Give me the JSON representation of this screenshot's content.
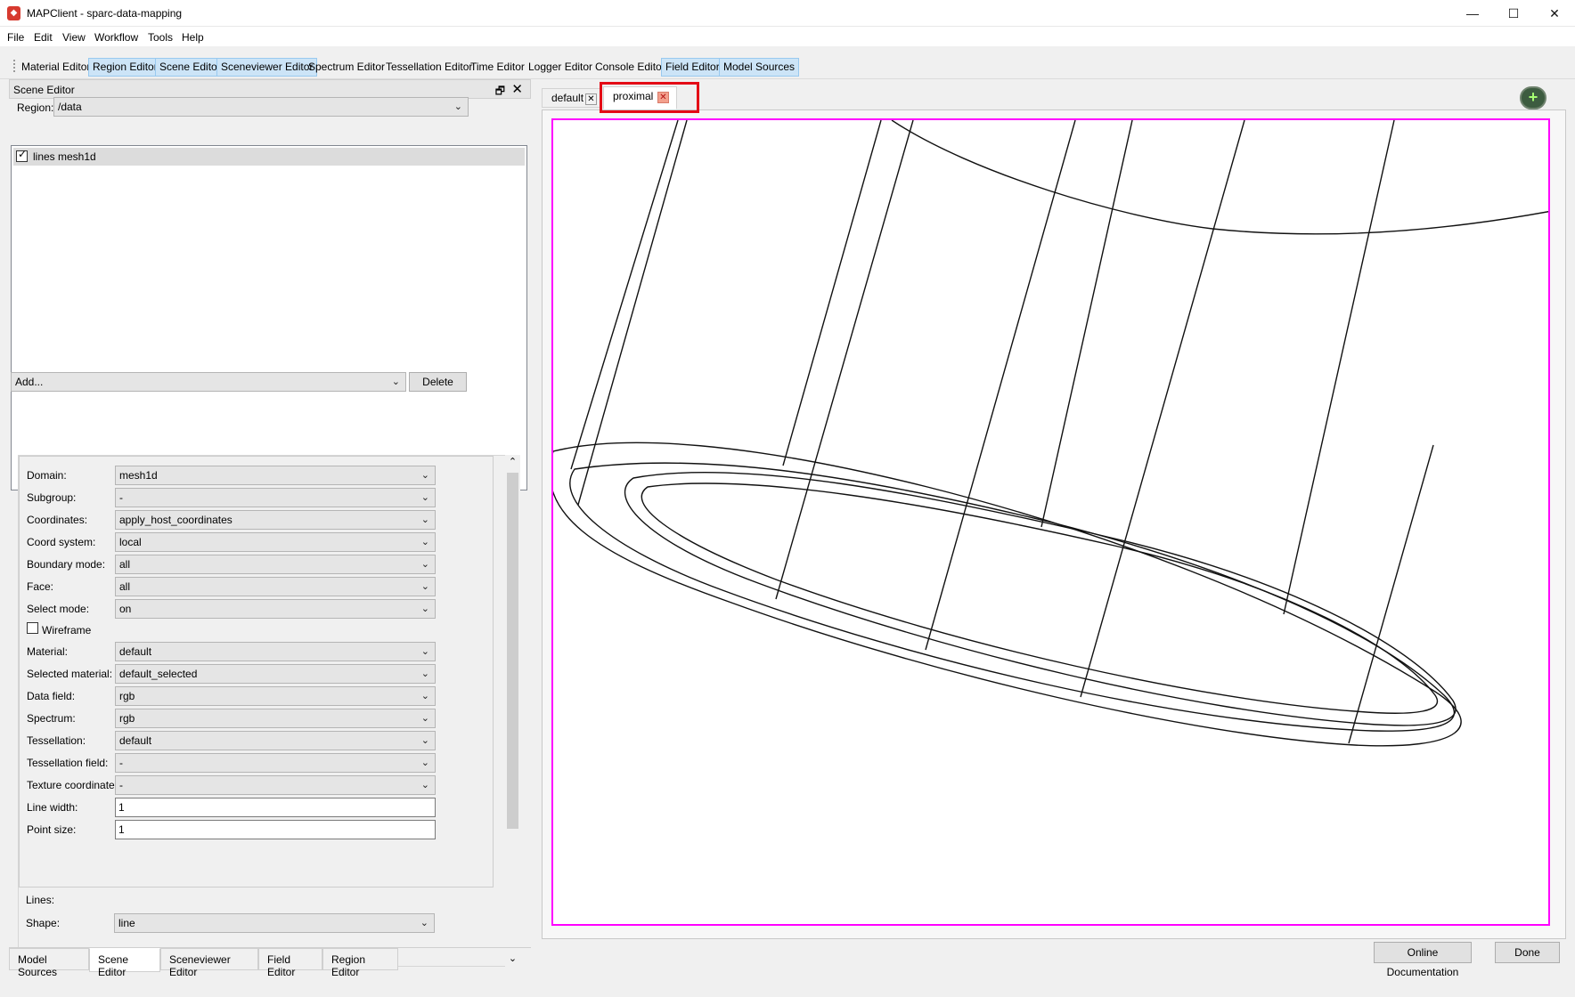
{
  "window": {
    "title": "MAPClient - sparc-data-mapping",
    "icon": "app-icon",
    "controls": {
      "minimize": "—",
      "maximize": "☐",
      "close": "✕"
    }
  },
  "menubar": {
    "items": [
      "File",
      "Edit",
      "View",
      "Workflow",
      "Tools",
      "Help"
    ]
  },
  "toolbar": {
    "buttons": [
      {
        "label": "Material Editor",
        "active": false
      },
      {
        "label": "Region Editor",
        "active": true
      },
      {
        "label": "Scene Editor",
        "active": true
      },
      {
        "label": "Sceneviewer Editor",
        "active": true
      },
      {
        "label": "Spectrum Editor",
        "active": false
      },
      {
        "label": "Tessellation Editor",
        "active": false
      },
      {
        "label": "Time Editor",
        "active": false
      },
      {
        "label": "Logger Editor",
        "active": false
      },
      {
        "label": "Console Editor",
        "active": false
      },
      {
        "label": "Field Editor",
        "active": true
      },
      {
        "label": "Model Sources",
        "active": true
      }
    ]
  },
  "scene_editor": {
    "title": "Scene Editor",
    "float_icon": "🗗",
    "close_icon": "✕",
    "region_label": "Region:",
    "region_value": "/data",
    "graphics": [
      {
        "label": "lines mesh1d",
        "checked": true
      }
    ],
    "add_value": "Add...",
    "delete_label": "Delete",
    "properties": {
      "domain": {
        "label": "Domain:",
        "value": "mesh1d"
      },
      "subgroup": {
        "label": "Subgroup:",
        "value": "-"
      },
      "coordinates": {
        "label": "Coordinates:",
        "value": "apply_host_coordinates"
      },
      "coord_system": {
        "label": "Coord system:",
        "value": "local"
      },
      "boundary_mode": {
        "label": "Boundary mode:",
        "value": "all"
      },
      "face": {
        "label": "Face:",
        "value": "all"
      },
      "select_mode": {
        "label": "Select mode:",
        "value": "on"
      },
      "wireframe": {
        "label": "Wireframe",
        "checked": false
      },
      "material": {
        "label": "Material:",
        "value": "default"
      },
      "selected_material": {
        "label": "Selected material:",
        "value": "default_selected"
      },
      "data_field": {
        "label": "Data field:",
        "value": "rgb"
      },
      "spectrum": {
        "label": "Spectrum:",
        "value": "rgb"
      },
      "tessellation": {
        "label": "Tessellation:",
        "value": "default"
      },
      "tessellation_field": {
        "label": "Tessellation field:",
        "value": "-"
      },
      "texture_coordinates": {
        "label": "Texture coordinates:",
        "value": "-"
      },
      "line_width": {
        "label": "Line width:",
        "value": "1"
      },
      "point_size": {
        "label": "Point size:",
        "value": "1"
      },
      "lines_group_label": "Lines:",
      "shape": {
        "label": "Shape:",
        "value": "line"
      }
    }
  },
  "bottom_tabs": [
    {
      "label": "Model Sources",
      "active": false
    },
    {
      "label": "Scene Editor",
      "active": true
    },
    {
      "label": "Sceneviewer Editor",
      "active": false
    },
    {
      "label": "Field Editor",
      "active": false
    },
    {
      "label": "Region Editor",
      "active": false
    }
  ],
  "viewer": {
    "tabs": [
      {
        "label": "default",
        "active": false
      },
      {
        "label": "proximal",
        "active": true,
        "highlighted": true
      }
    ],
    "tab_close_glyph": "✕",
    "add_view_icon": "+",
    "border_color": "#ff00ff",
    "highlight_color": "#e40b16"
  },
  "footer": {
    "online_docs_label": "Online Documentation",
    "done_label": "Done"
  },
  "colors": {
    "toolbar_active": "#cce4f7",
    "graphics_line": "#111111"
  }
}
